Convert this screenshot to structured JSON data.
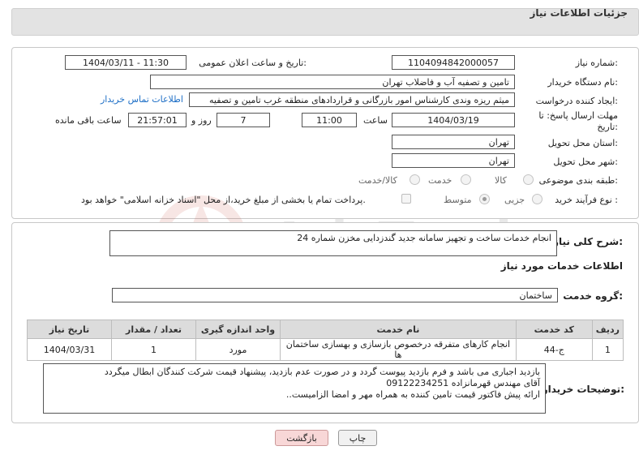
{
  "header": {
    "title": "جزئیات اطلاعات نیاز"
  },
  "form": {
    "need_number_label": "شماره نیاز:",
    "need_number": "1104094842000057",
    "announce_label": "تاریخ و ساعت اعلان عمومی:",
    "announce_value": "1404/03/11 - 11:30",
    "buyer_label": "نام دستگاه خریدار:",
    "buyer_value": "تامین و تصفیه آب و فاضلاب تهران",
    "creator_label": "ایجاد کننده درخواست:",
    "creator_value": "میثم ریزه وندی کارشناس امور بازرگانی و قراردادهای منطقه غرب تامین و تصفیه",
    "contact_link": "اطلاعات تماس خریدار",
    "deadline_label": "مهلت ارسال پاسخ: تا تاریخ:",
    "deadline_date": "1404/03/19",
    "time_label": "ساعت",
    "deadline_time": "11:00",
    "days_value": "7",
    "days_label": "روز و",
    "remaining_time": "21:57:01",
    "remaining_label": "ساعت باقی مانده",
    "province_label": "استان محل تحویل:",
    "province_value": "تهران",
    "city_label": "شهر محل تحویل:",
    "city_value": "تهران",
    "category_label": "طبقه بندی موضوعی:",
    "category_options": [
      "کالا",
      "خدمت",
      "کالا/خدمت"
    ],
    "process_label": "نوع فرآیند خرید :",
    "process_options": [
      "جزیی",
      "متوسط"
    ],
    "payment_note": "پرداخت تمام یا بخشی از مبلغ خرید،از محل \"اسناد خزانه اسلامی\" خواهد بود."
  },
  "summary": {
    "label": "شرح کلی نیاز:",
    "value": "انجام خدمات ساخت و تجهیز سامانه جدید گندزدایی مخزن شماره 24"
  },
  "services": {
    "title": "اطلاعات خدمات مورد نیاز",
    "group_label": "گروه خدمت:",
    "group_value": "ساختمان",
    "columns": [
      "ردیف",
      "کد خدمت",
      "نام خدمت",
      "واحد اندازه گیری",
      "تعداد / مقدار",
      "تاریخ نیاز"
    ],
    "rows": [
      [
        "1",
        "ج-44",
        "انجام کارهای متفرقه درخصوص بازسازی و بهسازی ساختمان ها",
        "مورد",
        "1",
        "1404/03/31"
      ]
    ]
  },
  "buyer_notes": {
    "label": "توضیحات خریدار:",
    "lines": [
      "بازدید اجباری می باشد و فرم بازدید پیوست گردد و در صورت عدم بازدید، پیشنهاد قیمت شرکت کنندگان ابطال میگردد",
      "آقای مهندس قهرمانزاده 09122234251",
      "ارائه پیش فاکتور قیمت تامین کننده به همراه مهر و امضا الزامیست.."
    ]
  },
  "buttons": {
    "print": "چاپ",
    "back": "بازگشت"
  },
  "watermark": {
    "text": "AriaTender.neT"
  }
}
